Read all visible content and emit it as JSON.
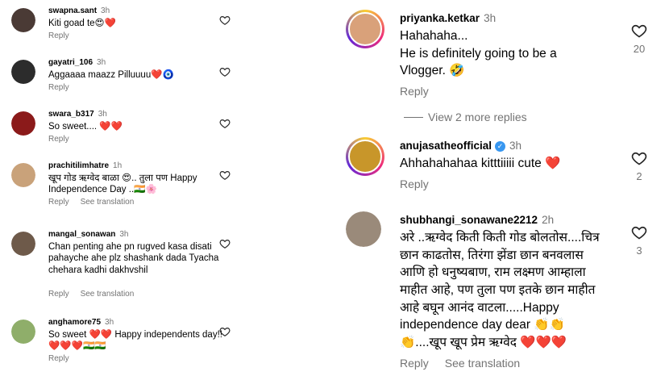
{
  "left_comments": [
    {
      "user": "swapna.sant",
      "time": "3h",
      "text": "Kiti goad te😍❤️",
      "reply": "Reply",
      "see_translation": "",
      "avatar_color": "#4a3a35"
    },
    {
      "user": "gayatri_106",
      "time": "3h",
      "text": "Aggaaaa maazz Pilluuuu❤️🧿",
      "reply": "Reply",
      "see_translation": "",
      "avatar_color": "#2c2c2c"
    },
    {
      "user": "swara_b317",
      "time": "3h",
      "text": "So sweet.... ❤️❤️",
      "reply": "Reply",
      "see_translation": "",
      "avatar_color": "#8b1a1a"
    },
    {
      "user": "prachitilimhatre",
      "time": "1h",
      "text": "खूप गोड ऋग्वेद बाळा 😍.. तुला पण Happy Independence Day ..🇮🇳🌸",
      "reply": "Reply",
      "see_translation": "See translation",
      "avatar_color": "#c9a27a"
    },
    {
      "user": "mangal_sonawan",
      "time": "3h",
      "text": "Chan penting ahe pn rugved kasa disati pahayche ahe plz shashank dada Tyacha chehara kadhi dakhvshil",
      "reply": "Reply",
      "see_translation": "See translation",
      "avatar_color": "#6e5a4a"
    },
    {
      "user": "anghamore75",
      "time": "3h",
      "text": "So sweet ❤️❤️ Happy independents day!! ❤️❤️❤️🇮🇳🇮🇳",
      "reply": "Reply",
      "see_translation": "",
      "avatar_color": "#8fae6a"
    }
  ],
  "right_comments": [
    {
      "user": "priyanka.ketkar",
      "time": "3h",
      "text_lines": [
        "Hahahaha...",
        "He is definitely going to be a",
        "Vlogger. 🤣"
      ],
      "reply": "Reply",
      "see_translation": "",
      "likes": "20",
      "verified": false,
      "avatar_color": "#d9a17a"
    },
    {
      "user": "anujasatheofficial",
      "time": "3h",
      "text_lines": [
        "Ahhahahahaa kitttiiiii cute ❤️"
      ],
      "reply": "Reply",
      "see_translation": "",
      "likes": "2",
      "verified": true,
      "avatar_color": "#c8962a"
    },
    {
      "user": "shubhangi_sonawane2212",
      "time": "2h",
      "text_lines": [
        "अरे ..ऋग्वेद किती किती गोड बोलतोस....चित्र",
        "छान काढतोस, तिरंगा झेंडा छान बनवलास",
        "आणि हो धनुष्यबाण, राम लक्ष्मण आम्हाला",
        "माहीत आहे, पण तुला पण इतके छान माहीत",
        "आहे बघून आनंद वाटला.....Happy",
        "independence day dear 👏👏",
        "👏....खूप खूप प्रेम ऋग्वेद ❤️❤️❤️"
      ],
      "reply": "Reply",
      "see_translation": "See translation",
      "likes": "3",
      "verified": false,
      "avatar_color": "#9a8a7a"
    }
  ],
  "view_more": "View 2 more replies",
  "icons": {
    "like": "heart-outline-icon",
    "verified": "verified-badge-icon"
  },
  "verified_mark": "✓"
}
